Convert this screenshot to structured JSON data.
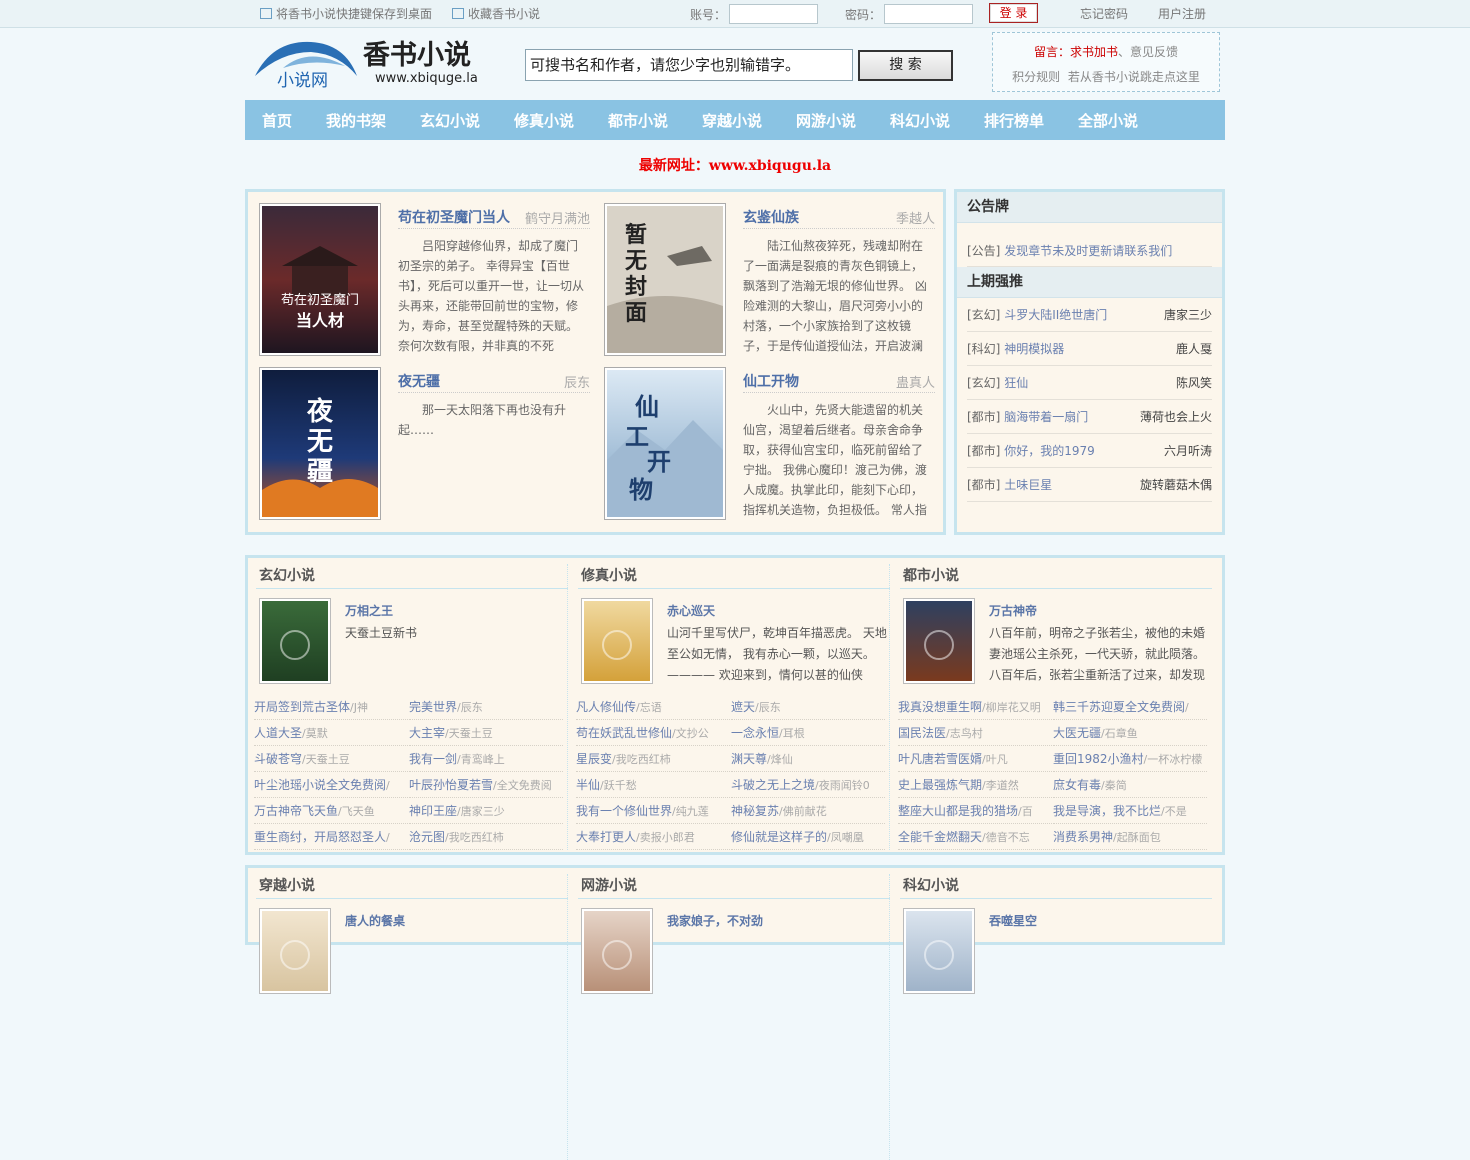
{
  "topbar": {
    "shortcut": "将香书小说快捷键保存到桌面",
    "favorite": "收藏香书小说",
    "account_label": "账号：",
    "password_label": "密码：",
    "login": "登 录",
    "forgot": "忘记密码",
    "register": "用户注册"
  },
  "logo": {
    "brand": "香书小说",
    "small": "小说网",
    "domain": "www.xbiquge.la"
  },
  "search": {
    "value": "可搜书名和作者，请您少字也别输错字。",
    "button": "搜 索"
  },
  "notice": {
    "msg_label": "留言：",
    "req": "求书加书",
    "sep": "、",
    "feedback": "意见反馈",
    "rules": "积分规则",
    "rule_text": "若从香书小说跳走点这里"
  },
  "nav": [
    "首页",
    "我的书架",
    "玄幻小说",
    "修真小说",
    "都市小说",
    "穿越小说",
    "网游小说",
    "科幻小说",
    "排行榜单",
    "全部小说"
  ],
  "newurl": "最新网址：www.xbiqugu.la",
  "featured": [
    {
      "title": "苟在初圣魔门当人",
      "author": "鹤守月满池",
      "desc": "吕阳穿越修仙界，却成了魔门初圣宗的弟子。 幸得异宝【百世书】，死后可以重开一世，让一切从头再来，还能带回前世的宝物，修为，寿命，甚至觉醒特殊的天赋。 奈何次数有限，并非真的不死",
      "cover": "苟在初圣魔门当人材"
    },
    {
      "title": "玄鉴仙族",
      "author": "季越人",
      "desc": "陆江仙熬夜猝死，残魂却附在了一面满是裂痕的青灰色铜镜上，飘落到了浩瀚无垠的修仙世界。 凶险难测的大黎山，眉尺河旁小小的村落，一个小家族拾到了这枚镜子，于是传仙道授仙法，开启波澜",
      "cover": "暂无封面"
    },
    {
      "title": "夜无疆",
      "author": "辰东",
      "desc": "那一天太阳落下再也没有升起……",
      "cover": "夜无疆"
    },
    {
      "title": "仙工开物",
      "author": "蛊真人",
      "desc": "火山中，先贤大能遗留的机关仙宫，渴望着后继者。母亲舍命争取，获得仙宫宝印，临死前留给了宁拙。 我佛心魔印！渡己为佛，渡人成魔。执掌此印，能刻下心印，指挥机关造物，负担极低。 常人指",
      "cover": "仙工开物"
    }
  ],
  "board": {
    "title": "公告牌",
    "announce": {
      "cat": "[公告]",
      "text": "发现章节未及时更新请联系我们"
    },
    "recommend_title": "上期强推",
    "recommend": [
      {
        "cat": "[玄幻]",
        "title": "斗罗大陆II绝世唐门",
        "author": "唐家三少"
      },
      {
        "cat": "[科幻]",
        "title": "神明模拟器",
        "author": "鹿人戛"
      },
      {
        "cat": "[玄幻]",
        "title": "狂仙",
        "author": "陈风笑"
      },
      {
        "cat": "[都市]",
        "title": "脑海带着一扇门",
        "author": "薄荷也会上火"
      },
      {
        "cat": "[都市]",
        "title": "你好，我的1979",
        "author": "六月听涛"
      },
      {
        "cat": "[都市]",
        "title": "土味巨星",
        "author": "旋转蘑菇木偶"
      }
    ]
  },
  "sections": [
    [
      {
        "title": "玄幻小说",
        "top": {
          "title": "万相之王",
          "desc": "天蚕土豆新书",
          "cover": "万相之王"
        },
        "list": [
          [
            "开局签到荒古圣体",
            "/J神"
          ],
          [
            "完美世界",
            "/辰东"
          ],
          [
            "人道大圣",
            "/莫默"
          ],
          [
            "大主宰",
            "/天蚕土豆"
          ],
          [
            "斗破苍穹",
            "/天蚕土豆"
          ],
          [
            "我有一剑",
            "/青鸾峰上"
          ],
          [
            "叶尘池瑶小说全文免费阅",
            "/"
          ],
          [
            "叶辰孙怡夏若雪",
            "/全文免费阅"
          ],
          [
            "万古神帝飞天鱼",
            "/飞天鱼"
          ],
          [
            "神印王座",
            "/唐家三少"
          ],
          [
            "重生商纣，开局怒怼圣人",
            "/"
          ],
          [
            "沧元图",
            "/我吃西红柿"
          ]
        ]
      },
      {
        "title": "修真小说",
        "top": {
          "title": "赤心巡天",
          "desc": "山河千里写伏尸，乾坤百年描恶虎。 天地至公如无情， 我有赤心一颗，以巡天。 ———— 欢迎来到，情何以甚的仙侠",
          "cover": "赤心巡天"
        },
        "list": [
          [
            "凡人修仙传",
            "/忘语"
          ],
          [
            "遮天",
            "/辰东"
          ],
          [
            "苟在妖武乱世修仙",
            "/文抄公"
          ],
          [
            "一念永恒",
            "/耳根"
          ],
          [
            "星辰变",
            "/我吃西红柿"
          ],
          [
            "渊天尊",
            "/烽仙"
          ],
          [
            "半仙",
            "/跃千愁"
          ],
          [
            "斗破之无上之境",
            "/夜雨闻铃0"
          ],
          [
            "我有一个修仙世界",
            "/纯九莲"
          ],
          [
            "神秘复苏",
            "/佛前献花"
          ],
          [
            "大奉打更人",
            "/卖报小郎君"
          ],
          [
            "修仙就是这样子的",
            "/凤嘲凰"
          ]
        ]
      },
      {
        "title": "都市小说",
        "top": {
          "title": "万古神帝",
          "desc": "八百年前，明帝之子张若尘，被他的未婚妻池瑶公主杀死，一代天骄，就此陨落。 八百年后，张若尘重新活了过来，却发现",
          "cover": "万古神帝"
        },
        "list": [
          [
            "我真没想重生啊",
            "/柳岸花又明"
          ],
          [
            "韩三千苏迎夏全文免费阅",
            "/"
          ],
          [
            "国民法医",
            "/志鸟村"
          ],
          [
            "大医无疆",
            "/石章鱼"
          ],
          [
            "叶凡唐若雪医婿",
            "/叶凡"
          ],
          [
            "重回1982小渔村",
            "/一杯冰柠檬"
          ],
          [
            "史上最强炼气期",
            "/李道然"
          ],
          [
            "庶女有毒",
            "/秦简"
          ],
          [
            "整座大山都是我的猎场",
            "/百"
          ],
          [
            "我是导演，我不比烂",
            "/不是"
          ],
          [
            "全能千金燃翻天",
            "/德音不忘"
          ],
          [
            "消费系男神",
            "/起酥面包"
          ]
        ]
      }
    ],
    [
      {
        "title": "穿越小说",
        "top": {
          "title": "唐人的餐桌",
          "desc": "",
          "cover": "唐人的餐桌"
        },
        "list": []
      },
      {
        "title": "网游小说",
        "top": {
          "title": "我家娘子，不对劲",
          "desc": "",
          "cover": "我家娘子"
        },
        "list": []
      },
      {
        "title": "科幻小说",
        "top": {
          "title": "吞噬星空",
          "desc": "",
          "cover": "吞噬星空"
        },
        "list": []
      }
    ]
  ],
  "colors": {
    "nav": "#8ac3e3",
    "border": "#c6e4ee",
    "panel": "#fcf6ec",
    "link": "#6a80b0",
    "accent": "#e00000"
  }
}
